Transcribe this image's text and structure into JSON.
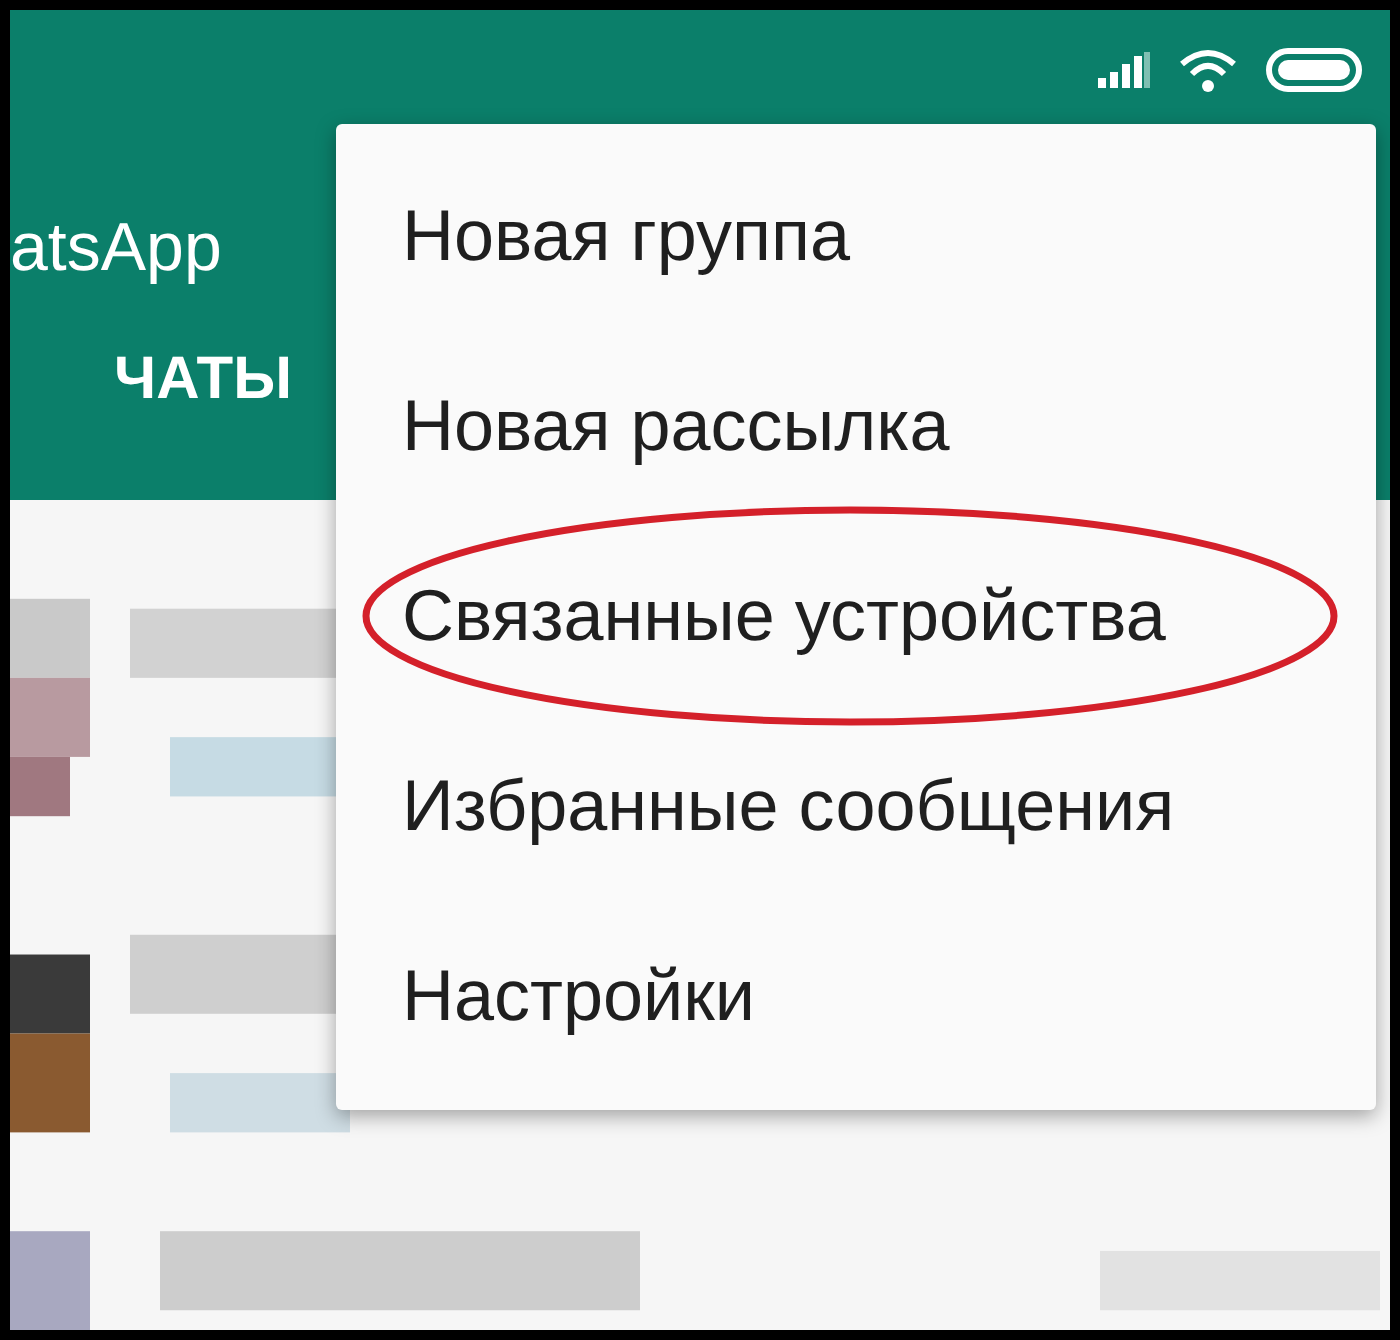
{
  "app_bar": {
    "title": "atsApp",
    "tabs": [
      {
        "label": "ЧАТЫ",
        "selected": true
      }
    ]
  },
  "menu": {
    "items": [
      {
        "label": "Новая группа",
        "circled": false
      },
      {
        "label": "Новая рассылка",
        "circled": false
      },
      {
        "label": "Связанные устройства",
        "circled": true
      },
      {
        "label": "Избранные сообщения",
        "circled": false
      },
      {
        "label": "Настройки",
        "circled": false
      }
    ]
  }
}
